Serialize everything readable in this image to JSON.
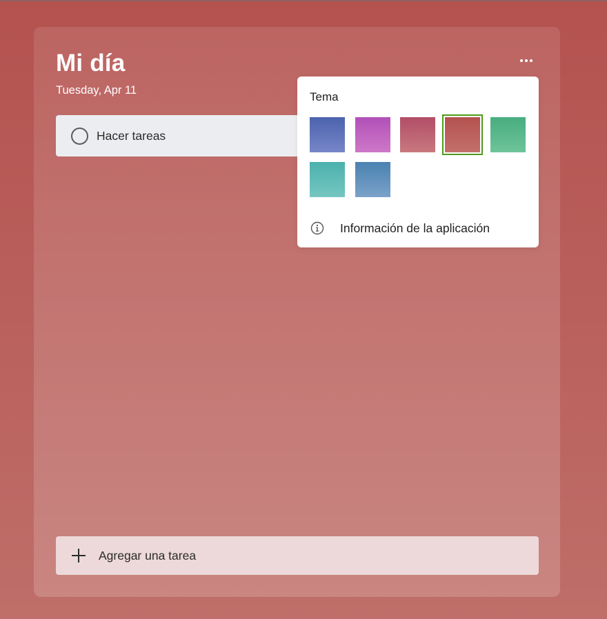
{
  "header": {
    "title": "Mi día",
    "date": "Tuesday, Apr 11"
  },
  "tasks": [
    {
      "label": "Hacer tareas",
      "completed": false
    }
  ],
  "theme_menu": {
    "title": "Tema",
    "swatches": [
      {
        "name": "blue",
        "top": "#4b63ad",
        "bottom": "#7786c8",
        "selected": false
      },
      {
        "name": "purple",
        "top": "#b150b8",
        "bottom": "#cd78c8",
        "selected": false
      },
      {
        "name": "rose",
        "top": "#b14e67",
        "bottom": "#c9787f",
        "selected": false
      },
      {
        "name": "red",
        "top": "#b4524f",
        "bottom": "#c3706b",
        "selected": true
      },
      {
        "name": "green",
        "top": "#48ad7f",
        "bottom": "#6ec499",
        "selected": false
      },
      {
        "name": "teal",
        "top": "#4bb1ad",
        "bottom": "#76c6c1",
        "selected": false
      },
      {
        "name": "steel-blue",
        "top": "#4a82b0",
        "bottom": "#7aa2c9",
        "selected": false
      }
    ],
    "info_label": "Información de la aplicación"
  },
  "add_task": {
    "label": "Agregar una tarea"
  },
  "colors": {
    "background": "#b4524f",
    "selected_outline": "#4c9a1a"
  }
}
